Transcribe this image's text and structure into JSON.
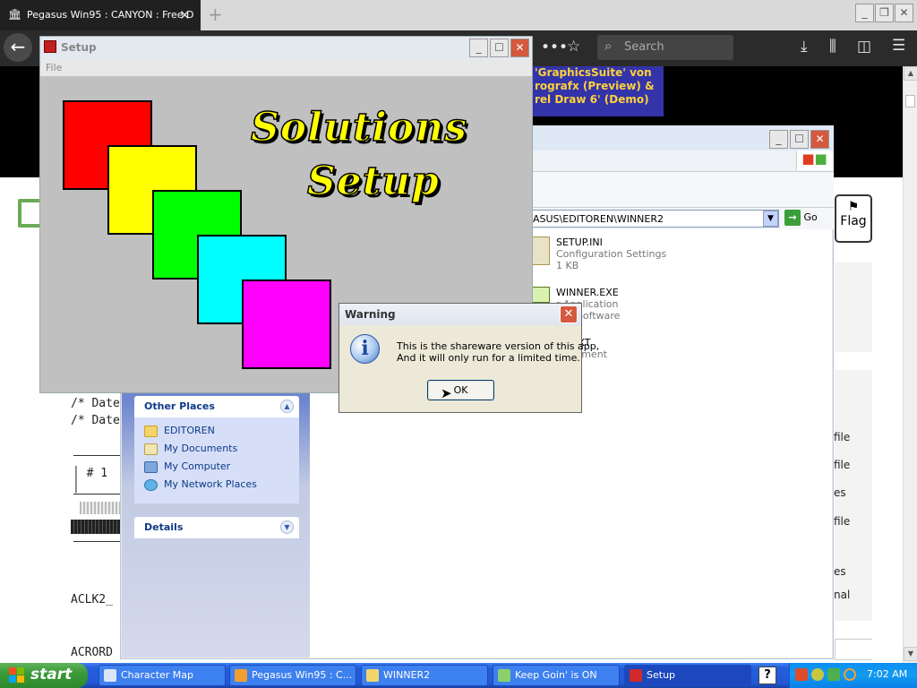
{
  "browser": {
    "tab_title": "Pegasus Win95 : CANYON : Free D",
    "tab_close": "✕",
    "new_tab": "+",
    "search_placeholder": "Search",
    "flag_label": "Flag"
  },
  "page": {
    "banner_lines": [
      "'GraphicsSuite' von",
      "rografx (Preview) &",
      "rel Draw 6' (Demo)"
    ],
    "code_lines": [
      "/* Dateilis",
      "/* Dateie"
    ],
    "table_cell": "# 1",
    "filename1": "ACLK2_",
    "filename2": "ACRORD",
    "right_labels": [
      "file",
      "file",
      "es",
      "file",
      "es",
      "nal"
    ]
  },
  "explorer": {
    "address": "ASUS\\EDITOREN\\WINNER2",
    "go_label": "Go",
    "other_places_title": "Other Places",
    "places": [
      {
        "label": "EDITOREN",
        "icon": "folder-icon"
      },
      {
        "label": "My Documents",
        "icon": "my-documents-icon"
      },
      {
        "label": "My Computer",
        "icon": "my-computer-icon"
      },
      {
        "label": "My Network Places",
        "icon": "network-places-icon"
      }
    ],
    "details_title": "Details",
    "files": [
      {
        "name": "SETUP.INI",
        "line2": "Configuration Settings",
        "line3": "1 KB"
      },
      {
        "name": "WINNER.EXE",
        "line2": "r Application",
        "line3": "ons Software"
      },
      {
        "name": "ER.TXT",
        "line2": "Document",
        "line3": ""
      }
    ]
  },
  "setup": {
    "title": "Setup",
    "menu_file": "File",
    "logo_line1": "Solutions",
    "logo_line2": "Setup",
    "colors": [
      "#ff0000",
      "#ffff00",
      "#00ff00",
      "#00ffff",
      "#ff00ff"
    ]
  },
  "warning": {
    "title": "Warning",
    "message_line1": "This is the shareware version of this app,",
    "message_line2": "And it will only run for a limited time.",
    "ok_label": "OK",
    "close_glyph": "✕"
  },
  "taskbar": {
    "start_label": "start",
    "tasks": [
      {
        "label": "Character Map",
        "active": false
      },
      {
        "label": "Pegasus Win95 : C...",
        "active": false
      },
      {
        "label": "WINNER2",
        "active": false
      },
      {
        "label": "Keep Goin' is ON",
        "active": false
      },
      {
        "label": "Setup",
        "active": true
      }
    ],
    "help_glyph": "?",
    "clock": "7:02 AM"
  }
}
